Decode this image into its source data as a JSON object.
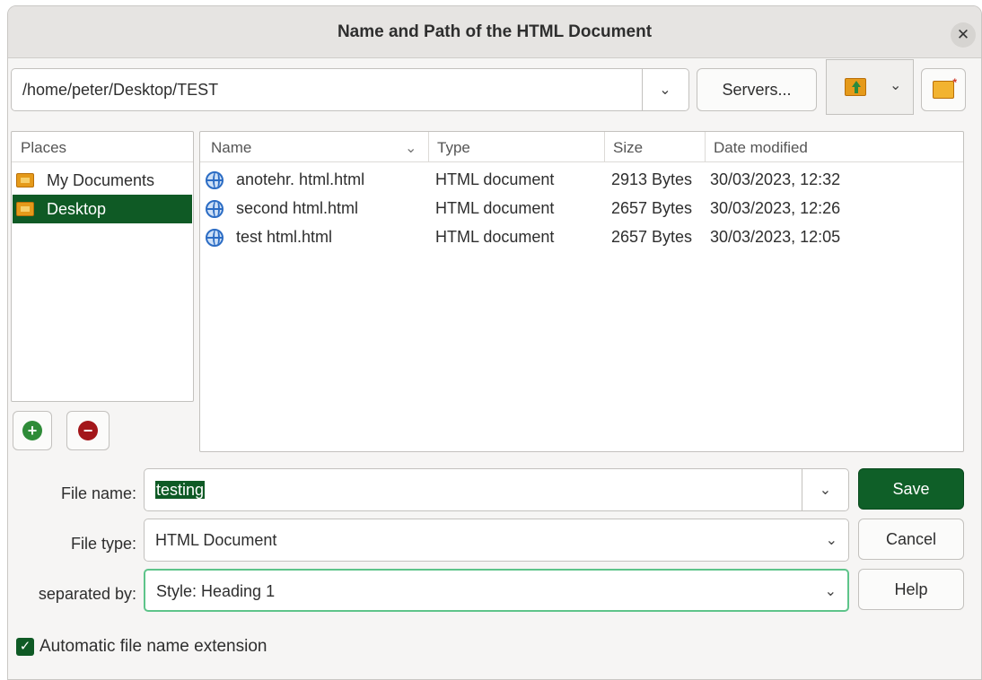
{
  "window": {
    "title": "Name and Path of the HTML Document",
    "close_icon": "close-icon"
  },
  "toolbar": {
    "path": "/home/peter/Desktop/TEST",
    "servers_label": "Servers...",
    "up_icon": "up-folder-icon",
    "new_folder_icon": "new-folder-icon"
  },
  "places": {
    "header": "Places",
    "items": [
      {
        "label": "My Documents",
        "icon": "folder-icon",
        "selected": false
      },
      {
        "label": "Desktop",
        "icon": "folder-icon",
        "selected": true
      }
    ],
    "add_icon": "add-icon",
    "remove_icon": "remove-icon"
  },
  "files": {
    "columns": [
      "Name",
      "Type",
      "Size",
      "Date modified"
    ],
    "rows": [
      {
        "name": "anotehr. html.html",
        "type": "HTML document",
        "size": "2913 Bytes",
        "date": "30/03/2023, 12:32"
      },
      {
        "name": "second html.html",
        "type": "HTML document",
        "size": "2657 Bytes",
        "date": "30/03/2023, 12:26"
      },
      {
        "name": "test html.html",
        "type": "HTML document",
        "size": "2657 Bytes",
        "date": "30/03/2023, 12:05"
      }
    ]
  },
  "form": {
    "file_name_label": "File name:",
    "file_name_value": "testing",
    "file_type_label": "File type:",
    "file_type_value": "HTML Document",
    "separated_by_label": "separated by:",
    "separated_by_value": "Style: Heading 1"
  },
  "buttons": {
    "save": "Save",
    "cancel": "Cancel",
    "help": "Help"
  },
  "options": {
    "auto_extension_label": "Automatic file name extension",
    "auto_extension_checked": true
  },
  "colors": {
    "accent": "#0f5a25",
    "save_button": "#0f5f28",
    "focus_border": "#5ec48a"
  }
}
